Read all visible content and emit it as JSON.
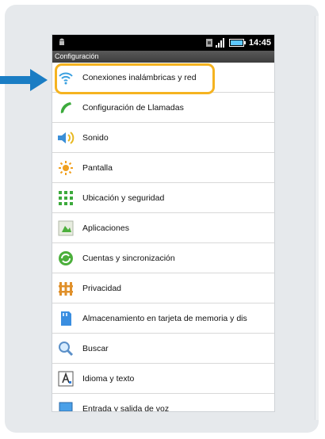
{
  "statusbar": {
    "time": "14:45",
    "home_icon": "android-icon",
    "notification_icon": "sim-icon",
    "signal_icon": "signal-icon",
    "battery_icon": "battery-icon"
  },
  "titlebar": {
    "title": "Configuración"
  },
  "settings": [
    {
      "label": "Conexiones inalámbricas y red",
      "icon": "wifi-icon"
    },
    {
      "label": "Configuración de Llamadas",
      "icon": "phone-icon"
    },
    {
      "label": "Sonido",
      "icon": "speaker-icon"
    },
    {
      "label": "Pantalla",
      "icon": "brightness-icon"
    },
    {
      "label": "Ubicación y seguridad",
      "icon": "location-grid-icon"
    },
    {
      "label": "Aplicaciones",
      "icon": "apps-icon"
    },
    {
      "label": "Cuentas y sincronización",
      "icon": "sync-icon"
    },
    {
      "label": "Privacidad",
      "icon": "privacy-fence-icon"
    },
    {
      "label": "Almacenamiento en tarjeta de memoria y dis",
      "icon": "sd-card-icon"
    },
    {
      "label": "Buscar",
      "icon": "search-icon"
    },
    {
      "label": "Idioma y texto",
      "icon": "keyboard-letter-icon"
    },
    {
      "label": "Entrada y salida de voz",
      "icon": "voice-monitor-icon"
    }
  ],
  "colors": {
    "highlight": "#f5b320",
    "arrow": "#1a7dc4",
    "card_background": "#e6e9ec"
  }
}
